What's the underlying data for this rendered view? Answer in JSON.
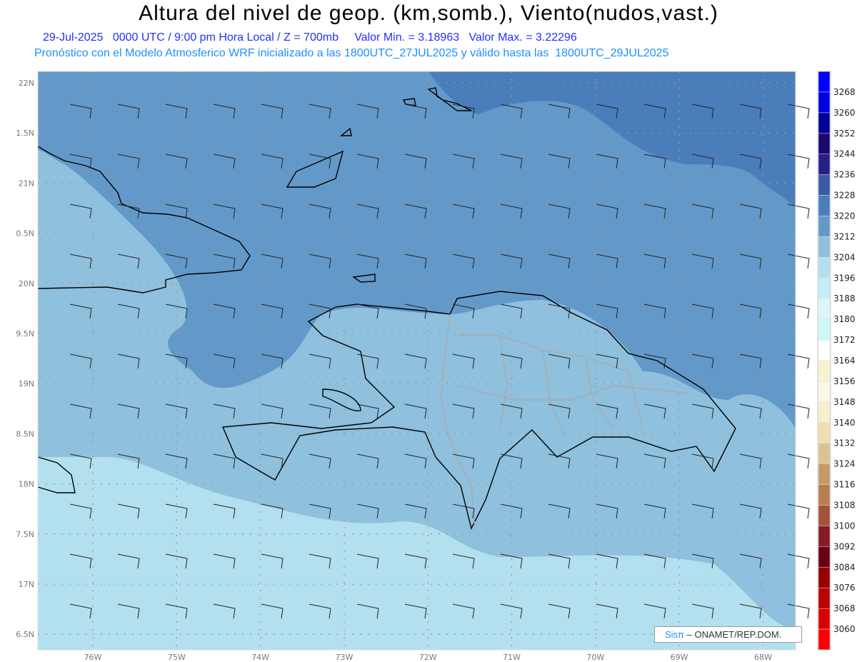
{
  "title": "Altura del nivel de geop. (km,somb.), Viento(nudos,vast.)",
  "subtitle": "29-Jul-2025   0000 UTC / 9:00 pm Hora Local / Z = 700mb     Valor Min. = 3.18963   Valor Max. = 3.22296",
  "subtitle2": "Pronóstico con el Modelo Atmosferico WRF inicializado a las 1800UTC_27JUL2025 y válido hasta las  1800UTC_29JUL2025",
  "lat_labels": [
    "22N",
    "1.5N",
    "21N",
    "0.5N",
    "20N",
    "9.5N",
    "19N",
    "8.5N",
    "18N",
    "7.5N",
    "17N",
    "6.5N"
  ],
  "lon_labels": [
    "76W",
    "75W",
    "74W",
    "73W",
    "72W",
    "71W",
    "70W",
    "69W",
    "68W"
  ],
  "colorbar": {
    "labels": [
      "3268",
      "3260",
      "3252",
      "3244",
      "3236",
      "3228",
      "3220",
      "3212",
      "3204",
      "3196",
      "3188",
      "3180",
      "3172",
      "3164",
      "3156",
      "3148",
      "3140",
      "3132",
      "3124",
      "3116",
      "3108",
      "3100",
      "3092",
      "3084",
      "3076",
      "3068",
      "3060"
    ],
    "colors": [
      "#0000ff",
      "#0000e0",
      "#00009a",
      "#1a0a6e",
      "#271f85",
      "#3a5aa5",
      "#4a7ebb",
      "#6399c8",
      "#8fc0dd",
      "#b3e0ee",
      "#c4eef5",
      "#dcf5f9",
      "#ccf8fa",
      "#ffffff",
      "#f8f3d0",
      "#fcf6e4",
      "#f7eecb",
      "#efdeb4",
      "#dcc192",
      "#c49a66",
      "#b77f4e",
      "#a0543a",
      "#861a26",
      "#6a0018",
      "#960000",
      "#bd0000",
      "#d80000",
      "#ff0000"
    ]
  },
  "logo": {
    "brand": "Sisπ",
    "text": "– ONAMET/REP.DOM."
  }
}
